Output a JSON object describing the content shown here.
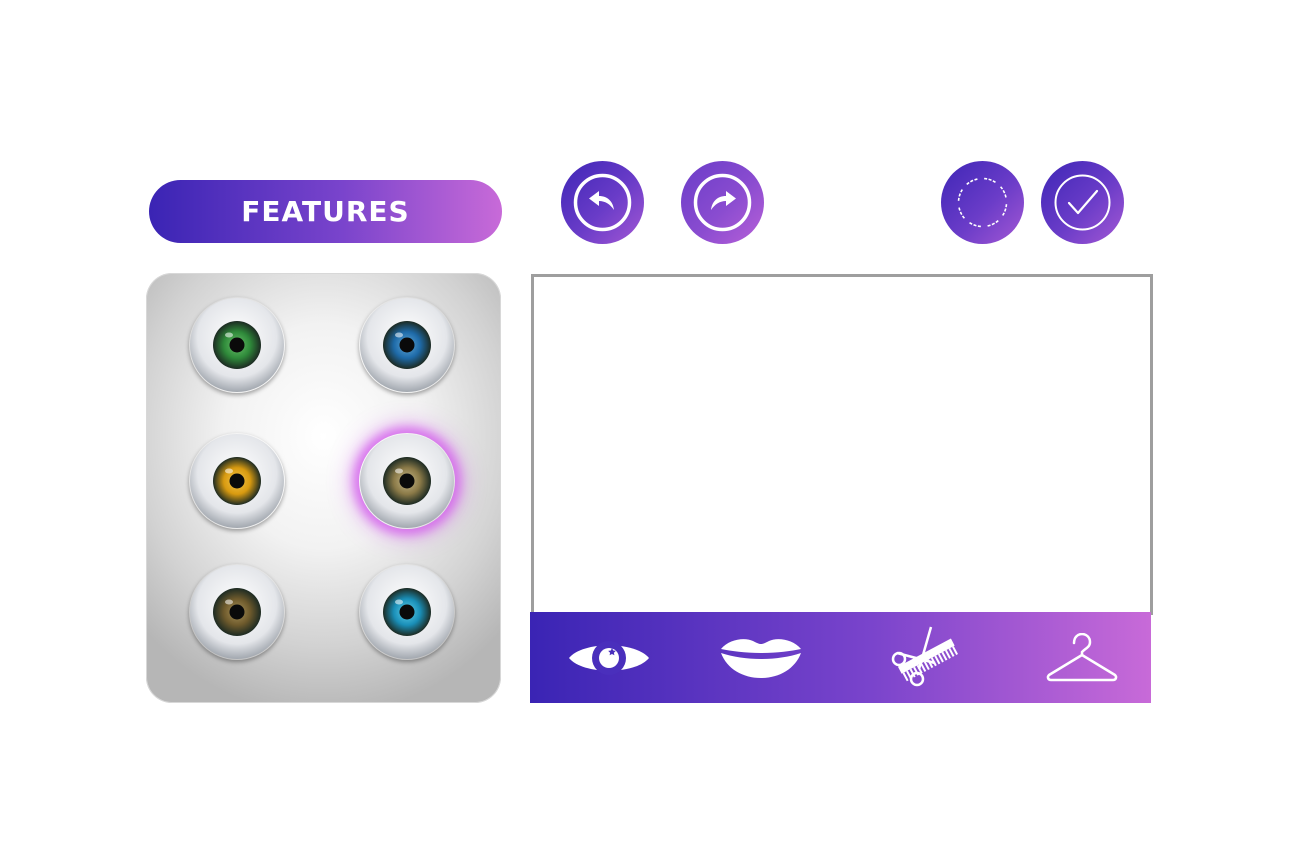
{
  "header": {
    "title": "FEATURES"
  },
  "toolbar": {
    "undo": {
      "icon": "undo-arrow-icon"
    },
    "redo": {
      "icon": "redo-arrow-icon"
    },
    "palette": {
      "icon": "color-palette-icon",
      "segment_colors": [
        "#e53935",
        "#f0a020",
        "#f3d23a",
        "#7cc242"
      ]
    },
    "confirm": {
      "icon": "checkmark-icon"
    }
  },
  "eye_options": [
    {
      "color_name": "green",
      "iris": "#2f8a3a",
      "iris_light": "#69c06a"
    },
    {
      "color_name": "blue",
      "iris": "#1e6aa8",
      "iris_light": "#5fa8d8"
    },
    {
      "color_name": "amber",
      "iris": "#d89a10",
      "iris_light": "#f4c64a"
    },
    {
      "color_name": "hazel",
      "iris": "#8b7a48",
      "iris_light": "#c7b98a",
      "selected": true
    },
    {
      "color_name": "brown",
      "iris": "#6e5a2c",
      "iris_light": "#a8925a"
    },
    {
      "color_name": "aqua",
      "iris": "#1a8fb8",
      "iris_light": "#5fd0ea"
    }
  ],
  "categories": [
    {
      "name": "eyes",
      "icon": "eye-icon"
    },
    {
      "name": "lips",
      "icon": "lips-icon"
    },
    {
      "name": "hair",
      "icon": "scissors-comb-icon"
    },
    {
      "name": "clothes",
      "icon": "hanger-icon"
    }
  ],
  "colors": {
    "gradient_start": "#3a24b4",
    "gradient_end": "#c86ad8",
    "selection_glow": "#d25aeb"
  }
}
